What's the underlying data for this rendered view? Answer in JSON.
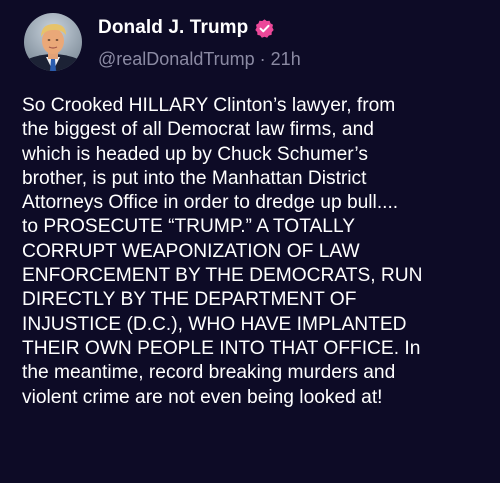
{
  "author": {
    "display_name": "Donald J. Trump",
    "handle": "@realDonaldTrump",
    "separator": "·",
    "time_ago": "21h",
    "verified": true,
    "avatar_icon": "profile-photo",
    "verified_icon": "verified-badge-icon"
  },
  "post": {
    "text": "So Crooked HILLARY Clinton’s lawyer, from\nthe biggest of all Democrat law firms, and\nwhich is headed up by Chuck Schumer’s\nbrother, is put into the Manhattan District\nAttorneys Office in order to dredge up bull....\nto PROSECUTE “TRUMP.” A TOTALLY\nCORRUPT WEAPONIZATION OF LAW\nENFORCEMENT BY THE DEMOCRATS, RUN\nDIRECTLY BY THE DEPARTMENT OF\nINJUSTICE (D.C.), WHO HAVE IMPLANTED\nTHEIR OWN PEOPLE INTO THAT OFFICE. In\nthe meantime, record breaking murders and\nviolent crime are not even being looked at!"
  },
  "colors": {
    "background": "#0d0b26",
    "text": "#ffffff",
    "secondary_text": "#8b8aa3",
    "verified_badge": "#ec4899"
  }
}
